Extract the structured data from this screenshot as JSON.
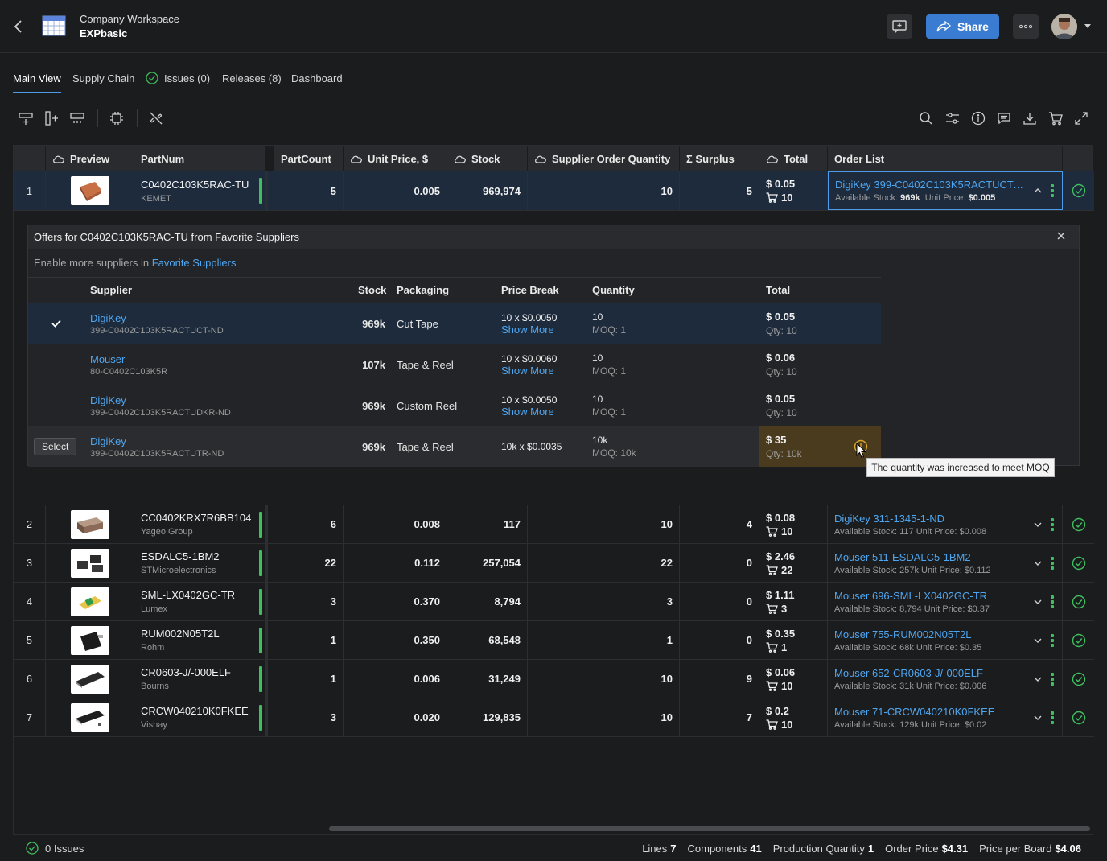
{
  "header": {
    "workspace": "Company Workspace",
    "project": "EXPbasic",
    "share_label": "Share"
  },
  "tabs": [
    {
      "label": "Main View"
    },
    {
      "label": "Supply Chain"
    },
    {
      "label": "Issues (0)"
    },
    {
      "label": "Releases (8)"
    },
    {
      "label": "Dashboard"
    }
  ],
  "columns": {
    "preview": "Preview",
    "partnum": "PartNum",
    "partcount": "PartCount",
    "unit_price": "Unit Price, $",
    "stock": "Stock",
    "supplier_qty": "Supplier Order Quantity",
    "surplus": "Σ Surplus",
    "total": "Total",
    "order_list": "Order List"
  },
  "rows": [
    {
      "idx": "1",
      "part": "C0402C103K5RAC-TU",
      "mfr": "KEMET",
      "count": "5",
      "price": "0.005",
      "stock": "969,974",
      "sqty": "10",
      "surplus": "5",
      "total": "$ 0.05",
      "tqty": "10",
      "order": "DigiKey 399-C0402C103K5RACTUCT-...",
      "avail_label": "Available Stock:",
      "avail": "969k",
      "up_label": "Unit Price:",
      "up": "$0.005"
    },
    {
      "idx": "2",
      "part": "CC0402KRX7R6BB104",
      "mfr": "Yageo Group",
      "count": "6",
      "price": "0.008",
      "stock": "117",
      "sqty": "10",
      "surplus": "4",
      "total": "$ 0.08",
      "tqty": "10",
      "order": "DigiKey 311-1345-1-ND",
      "info": "Available Stock: 117  Unit Price: $0.008"
    },
    {
      "idx": "3",
      "part": "ESDALC5-1BM2",
      "mfr": "STMicroelectronics",
      "count": "22",
      "price": "0.112",
      "stock": "257,054",
      "sqty": "22",
      "surplus": "0",
      "total": "$ 2.46",
      "tqty": "22",
      "order": "Mouser 511-ESDALC5-1BM2",
      "info": "Available Stock: 257k  Unit Price: $0.112"
    },
    {
      "idx": "4",
      "part": "SML-LX0402GC-TR",
      "mfr": "Lumex",
      "count": "3",
      "price": "0.370",
      "stock": "8,794",
      "sqty": "3",
      "surplus": "0",
      "total": "$ 1.11",
      "tqty": "3",
      "order": "Mouser 696-SML-LX0402GC-TR",
      "info": "Available Stock: 8,794  Unit Price: $0.37"
    },
    {
      "idx": "5",
      "part": "RUM002N05T2L",
      "mfr": "Rohm",
      "count": "1",
      "price": "0.350",
      "stock": "68,548",
      "sqty": "1",
      "surplus": "0",
      "total": "$ 0.35",
      "tqty": "1",
      "order": "Mouser 755-RUM002N05T2L",
      "info": "Available Stock: 68k  Unit Price: $0.35"
    },
    {
      "idx": "6",
      "part": "CR0603-J/-000ELF",
      "mfr": "Bourns",
      "count": "1",
      "price": "0.006",
      "stock": "31,249",
      "sqty": "10",
      "surplus": "9",
      "total": "$ 0.06",
      "tqty": "10",
      "order": "Mouser 652-CR0603-J/-000ELF",
      "info": "Available Stock: 31k  Unit Price: $0.006"
    },
    {
      "idx": "7",
      "part": "CRCW040210K0FKEE",
      "mfr": "Vishay",
      "count": "3",
      "price": "0.020",
      "stock": "129,835",
      "sqty": "10",
      "surplus": "7",
      "total": "$ 0.2",
      "tqty": "10",
      "order": "Mouser 71-CRCW040210K0FKEE",
      "info": "Available Stock: 129k  Unit Price: $0.02"
    }
  ],
  "offers": {
    "title": "Offers for C0402C103K5RAC-TU from Favorite Suppliers",
    "enable_text": "Enable more suppliers in",
    "enable_link": "Favorite Suppliers",
    "headers": {
      "supplier": "Supplier",
      "stock": "Stock",
      "packaging": "Packaging",
      "price_break": "Price Break",
      "quantity": "Quantity",
      "total": "Total"
    },
    "items": [
      {
        "supplier": "DigiKey",
        "sku": "399-C0402C103K5RACTUCT-ND",
        "stock": "969k",
        "packaging": "Cut Tape",
        "pb": "10 x $0.0050",
        "more": "Show More",
        "qty": "10",
        "moq": "MOQ: 1",
        "total": "$ 0.05",
        "tq": "Qty: 10"
      },
      {
        "supplier": "Mouser",
        "sku": "80-C0402C103K5R",
        "stock": "107k",
        "packaging": "Tape & Reel",
        "pb": "10 x $0.0060",
        "more": "Show More",
        "qty": "10",
        "moq": "MOQ: 1",
        "total": "$ 0.06",
        "tq": "Qty: 10"
      },
      {
        "supplier": "DigiKey",
        "sku": "399-C0402C103K5RACTUDKR-ND",
        "stock": "969k",
        "packaging": "Custom Reel",
        "pb": "10 x $0.0050",
        "more": "Show More",
        "qty": "10",
        "moq": "MOQ: 1",
        "total": "$ 0.05",
        "tq": "Qty: 10"
      },
      {
        "supplier": "DigiKey",
        "sku": "399-C0402C103K5RACTUTR-ND",
        "stock": "969k",
        "packaging": "Tape & Reel",
        "pb": "10k x $0.0035",
        "more": "",
        "qty": "10k",
        "moq": "MOQ: 10k",
        "total": "$ 35",
        "tq": "Qty: 10k"
      }
    ],
    "select_label": "Select",
    "tooltip": "The quantity was increased to meet MOQ"
  },
  "footer": {
    "issues": "0 Issues",
    "lines_label": "Lines",
    "lines": "7",
    "components_label": "Components",
    "components": "41",
    "prodqty_label": "Production Quantity",
    "prodqty": "1",
    "orderprice_label": "Order Price",
    "orderprice": "$4.31",
    "ppb_label": "Price per Board",
    "ppb": "$4.06"
  },
  "colors": {
    "accent": "#4c9be8",
    "ok": "#3fbf5f",
    "link": "#4fa6f0",
    "share": "#3a7cd1"
  }
}
